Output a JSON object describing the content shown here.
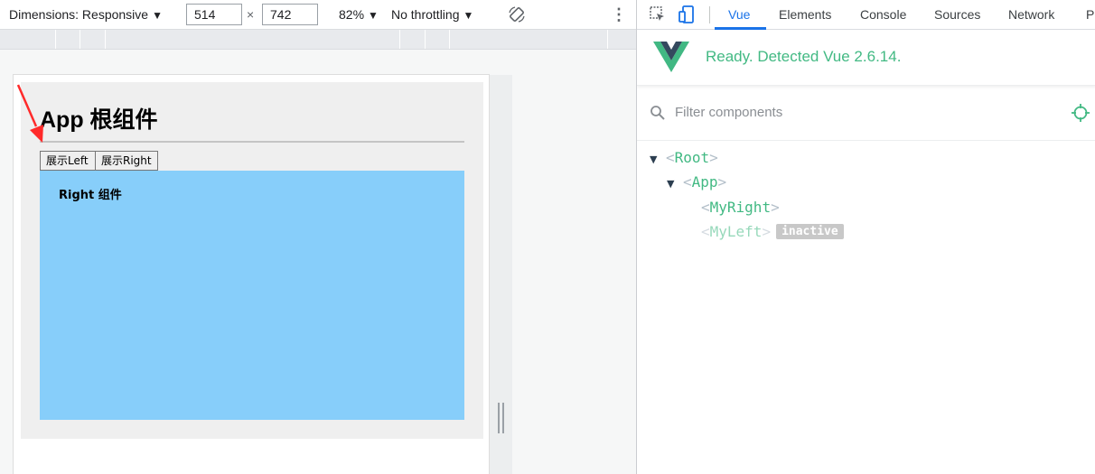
{
  "device_toolbar": {
    "dimensions_label": "Dimensions: Responsive",
    "width_value": "514",
    "times_sign": "×",
    "height_value": "742",
    "zoom_label": "82%",
    "throttling_label": "No throttling",
    "caret": "▼",
    "more_icon": "⋮"
  },
  "emulated_page": {
    "app_title": "App 根组件",
    "buttons": {
      "show_left": "展示Left",
      "show_right": "展示Right"
    },
    "right_component_title": "Right 组件",
    "colors": {
      "app_bg": "#efefef",
      "right_bg": "#87cefa",
      "arrow": "#ff2a2a"
    }
  },
  "devtools": {
    "tabs": [
      {
        "label": "Vue",
        "active": true
      },
      {
        "label": "Elements",
        "active": false
      },
      {
        "label": "Console",
        "active": false
      },
      {
        "label": "Sources",
        "active": false
      },
      {
        "label": "Network",
        "active": false
      },
      {
        "label": "Pe",
        "active": false
      }
    ],
    "vue_status": "Ready. Detected Vue 2.6.14.",
    "filter_placeholder": "Filter components",
    "accent_color": "#42b983",
    "tree": [
      {
        "name": "Root",
        "depth": 0,
        "expanded": true,
        "inactive": false
      },
      {
        "name": "App",
        "depth": 1,
        "expanded": true,
        "inactive": false
      },
      {
        "name": "MyRight",
        "depth": 2,
        "expanded": false,
        "inactive": false
      },
      {
        "name": "MyLeft",
        "depth": 2,
        "expanded": false,
        "inactive": true,
        "badge": "inactive"
      }
    ],
    "brackets": {
      "open": "<",
      "close": ">"
    }
  }
}
